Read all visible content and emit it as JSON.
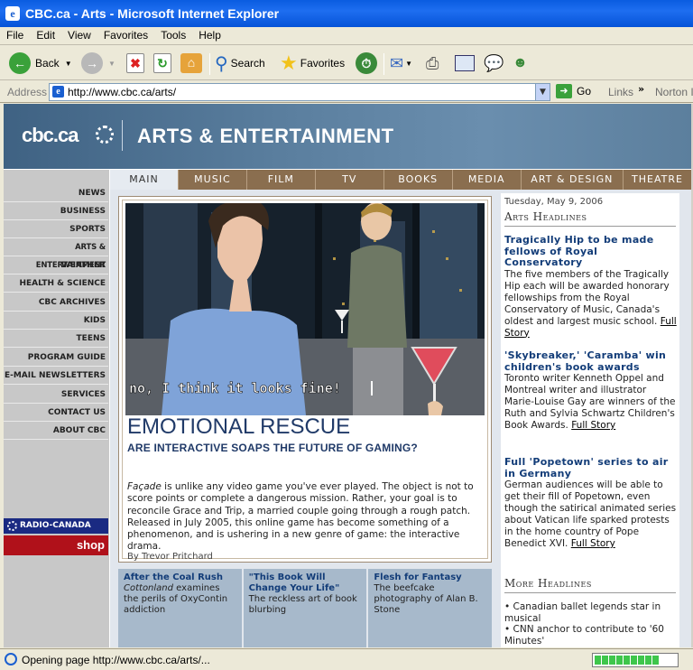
{
  "window": {
    "title": "CBC.ca - Arts - Microsoft Internet Explorer"
  },
  "menu": [
    "File",
    "Edit",
    "View",
    "Favorites",
    "Tools",
    "Help"
  ],
  "toolbar": {
    "back_label": "Back",
    "search_label": "Search",
    "favorites_label": "Favorites"
  },
  "address": {
    "label": "Address",
    "url": "http://www.cbc.ca/arts/",
    "go_label": "Go",
    "links_label": "Links",
    "norton_label": "Norton I"
  },
  "header": {
    "logo": "cbc.ca",
    "section_title": "ARTS & ENTERTAINMENT"
  },
  "tabs": [
    "MAIN",
    "MUSIC",
    "FILM",
    "TV",
    "BOOKS",
    "MEDIA",
    "ART & DESIGN",
    "THEATRE"
  ],
  "nav": [
    "NEWS",
    "BUSINESS",
    "SPORTS",
    "ARTS & ENTERTAINMENT",
    "WEATHER",
    "HEALTH & SCIENCE",
    "CBC ARCHIVES",
    "KIDS",
    "TEENS",
    "PROGRAM GUIDE",
    "E-MAIL NEWSLETTERS",
    "SERVICES",
    "CONTACT US",
    "ABOUT CBC"
  ],
  "radio_canada": "RADIO-CANADA",
  "shop": "shop",
  "feature": {
    "caption": "no, I think it looks fine!",
    "headline": "EMOTIONAL RESCUE",
    "subhead": "ARE INTERACTIVE SOAPS THE FUTURE OF GAMING?",
    "body_em": "Façade",
    "body": " is unlike any video game you've ever played. The object is not to score points or complete a dangerous mission. Rather, your goal is to reconcile Grace and Trip, a married couple going through a rough patch. Released in July 2005, this online game has become something of a phenomenon, and is ushering in a new genre of game: the interactive drama.",
    "byline": "By Trevor Pritchard"
  },
  "promos": [
    {
      "title": "After the Coal Rush",
      "em": "Cottonland",
      "text": " examines the perils of OxyContin addiction"
    },
    {
      "title": "\"This Book Will Change Your Life\"",
      "em": "",
      "text": "The reckless art of book blurbing"
    },
    {
      "title": "Flesh for Fantasy",
      "em": "",
      "text": "The beefcake photography of Alan B. Stone"
    }
  ],
  "right": {
    "date": "Tuesday, May 9, 2006",
    "headlines_title": "Arts Headlines",
    "stories": [
      {
        "title": "Tragically Hip to be made fellows of Royal Conservatory",
        "text": "The five members of the Tragically Hip each will be awarded honorary fellowships from the Royal Conservatory of Music, Canada's oldest and largest music school. ",
        "link": "Full Story"
      },
      {
        "title": "'Skybreaker,' 'Caramba' win children's book awards",
        "text": "Toronto writer Kenneth Oppel and Montreal writer and illustrator Marie-Louise Gay are winners of the Ruth and Sylvia Schwartz Children's Book Awards. ",
        "link": "Full Story"
      },
      {
        "title": "Full 'Popetown' series to air in Germany",
        "text": "German audiences will be able to get their fill of Popetown, even though the satirical animated series about Vatican life sparked protests in the home country of Pope Benedict XVI. ",
        "link": "Full Story"
      }
    ],
    "more_title": "More Headlines",
    "more": [
      "Canadian ballet legends star in musical",
      "CNN anchor to contribute to '60 Minutes'"
    ]
  },
  "status": {
    "text": "Opening page http://www.cbc.ca/arts/...",
    "progress": 0.85
  }
}
